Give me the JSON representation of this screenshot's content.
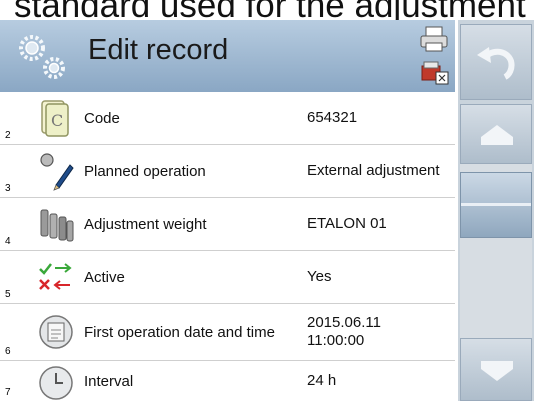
{
  "caption": "standard used for the adjustment",
  "header": {
    "title": "Edit record"
  },
  "rows": [
    {
      "num": "2",
      "label": "Code",
      "value": "654321",
      "icon": "code-icon"
    },
    {
      "num": "3",
      "label": "Planned operation",
      "value": "External adjustment",
      "icon": "planned-operation-icon"
    },
    {
      "num": "4",
      "label": "Adjustment weight",
      "value": "ETALON 01",
      "icon": "weights-icon"
    },
    {
      "num": "5",
      "label": "Active",
      "value": "Yes",
      "icon": "active-toggle-icon"
    },
    {
      "num": "6",
      "label": "First operation date and time",
      "value": "2015.06.11\n11:00:00",
      "icon": "calendar-icon"
    },
    {
      "num": "7",
      "label": "Interval",
      "value": "24 h",
      "icon": "clock-icon"
    }
  ],
  "colors": {
    "header_top": "#b7cce0",
    "header_bottom": "#8aa7c4",
    "sidebar": "#c9d3dc"
  }
}
